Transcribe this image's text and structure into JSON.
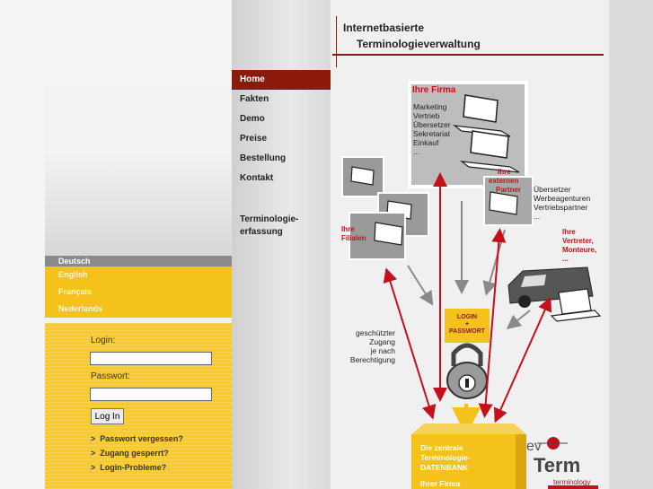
{
  "header": {
    "line1": "Internetbasierte",
    "line2": "Terminologieverwaltung"
  },
  "nav": {
    "items": [
      "Home",
      "Fakten",
      "Demo",
      "Preise",
      "Bestellung",
      "Kontakt"
    ],
    "active": "Home",
    "extra_line1": "Terminologie-",
    "extra_line2": "erfassung"
  },
  "languages": {
    "items": [
      "Deutsch",
      "English",
      "Français",
      "Nederlands"
    ],
    "active": "Deutsch"
  },
  "login": {
    "login_label": "Login:",
    "password_label": "Passwort:",
    "button": "Log In",
    "links": [
      "Passwort vergessen?",
      "Zugang gesperrt?",
      "Login-Probleme?"
    ]
  },
  "diagram": {
    "firma_title": "Ihre Firma",
    "firma_items": [
      "Marketing",
      "Vertrieb",
      "Übersetzer",
      "Sekretariat",
      "Einkauf",
      "..."
    ],
    "partner_title": [
      "Ihre",
      "externen",
      "Partner"
    ],
    "partner_items": [
      "Übersetzer",
      "Werbeagenturen",
      "Vertriebspartner",
      "..."
    ],
    "filialen_title": [
      "Ihre",
      "Filialen"
    ],
    "vertreter_title": [
      "Ihre",
      "Vertreter,",
      "Monteure,",
      "..."
    ],
    "login_box": [
      "LOGIN",
      "+",
      "PASSWORT"
    ],
    "protected": [
      "geschützter",
      "Zugang",
      "je nach",
      "Berechtigung"
    ],
    "db_text": [
      "Die zentrale",
      "Terminologie-",
      "DATENBANK",
      "Ihrer Firma"
    ],
    "logo_a": "ev",
    "logo_b": "Term",
    "logo_c": "terminology"
  },
  "colors": {
    "accent": "#8b1a0d",
    "yellow": "#f5c21b",
    "arrow_red": "#c4101a"
  }
}
